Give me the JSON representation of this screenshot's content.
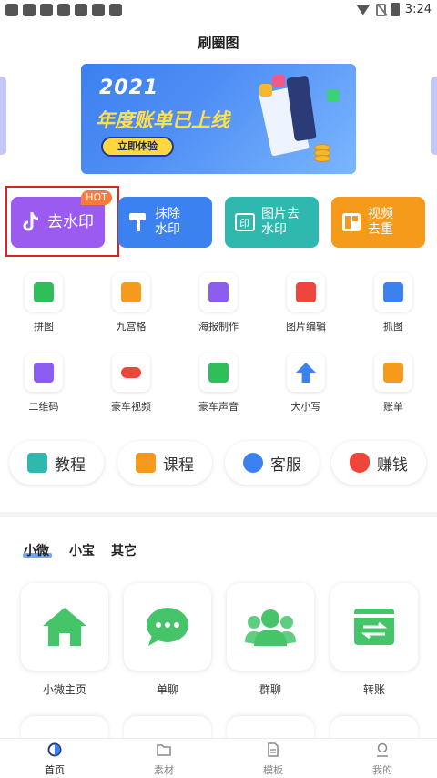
{
  "status_bar": {
    "time": "3:24"
  },
  "header": {
    "title": "刷圈图"
  },
  "banner": {
    "year": "2021",
    "headline": "年度账单已上线",
    "button_label": "立即体验"
  },
  "features": [
    {
      "label": "去水印",
      "badge": "HOT",
      "color": "#9b5bf0",
      "icon": "tiktok-icon"
    },
    {
      "label_line1": "抹除",
      "label_line2": "水印",
      "color": "#3b82f0",
      "icon": "paint-roller-icon"
    },
    {
      "label_line1": "图片去",
      "label_line2": "水印",
      "color": "#2fb8ad",
      "icon": "image-stamp-icon"
    },
    {
      "label_line1": "视频",
      "label_line2": "去重",
      "color": "#f59a1b",
      "icon": "video-dedup-icon"
    }
  ],
  "tools_row1": [
    {
      "label": "拼图",
      "color": "#2fbf5a",
      "icon": "collage-icon"
    },
    {
      "label": "九宫格",
      "color": "#f59a1b",
      "icon": "grid-nine-icon"
    },
    {
      "label": "海报制作",
      "color": "#8a5cf0",
      "icon": "poster-icon"
    },
    {
      "label": "图片编辑",
      "color": "#f0453a",
      "icon": "image-edit-icon"
    },
    {
      "label": "抓图",
      "color": "#3b82f0",
      "icon": "capture-image-icon"
    }
  ],
  "tools_row2": [
    {
      "label": "二维码",
      "color": "#8a5cf0",
      "icon": "qr-code-icon"
    },
    {
      "label": "豪车视频",
      "color": "#f0453a",
      "icon": "car-video-icon"
    },
    {
      "label": "豪车声音",
      "color": "#2fbf5a",
      "icon": "engine-sound-icon"
    },
    {
      "label": "大小写",
      "color": "#3b82f0",
      "icon": "arrow-up-icon"
    },
    {
      "label": "账单",
      "color": "#f59a1b",
      "icon": "yen-bill-icon"
    }
  ],
  "pills": [
    {
      "label": "教程",
      "color": "#2fb8ad",
      "icon": "book-icon"
    },
    {
      "label": "课程",
      "color": "#f59a1b",
      "icon": "open-book-icon"
    },
    {
      "label": "客服",
      "color": "#3b82f0",
      "icon": "support-icon"
    },
    {
      "label": "赚钱",
      "color": "#f0453a",
      "icon": "money-bag-icon"
    }
  ],
  "tabs": [
    {
      "label": "小微"
    },
    {
      "label": "小宝"
    },
    {
      "label": "其它"
    }
  ],
  "apps": [
    {
      "label": "小微主页",
      "color": "#45c46a",
      "icon": "home-icon"
    },
    {
      "label": "单聊",
      "color": "#45c46a",
      "icon": "chat-bubble-icon"
    },
    {
      "label": "群聊",
      "color": "#45c46a",
      "icon": "group-icon"
    },
    {
      "label": "转账",
      "color": "#45c46a",
      "icon": "transfer-icon"
    }
  ],
  "nav": [
    {
      "label": "首页",
      "icon": "home-nav-icon"
    },
    {
      "label": "素材",
      "icon": "folder-icon"
    },
    {
      "label": "模板",
      "icon": "document-icon"
    },
    {
      "label": "我的",
      "icon": "profile-icon"
    }
  ]
}
